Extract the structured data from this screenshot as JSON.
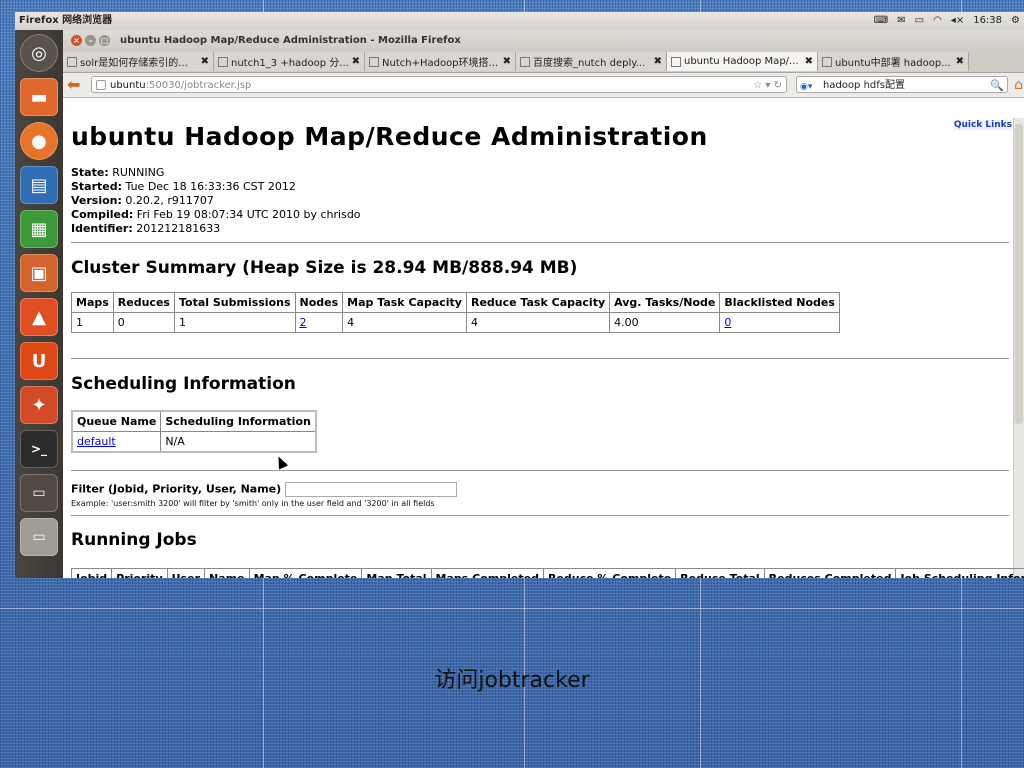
{
  "top_panel": {
    "app_name": "Firefox 网络浏览器",
    "clock": "16:38"
  },
  "window": {
    "title": "ubuntu Hadoop Map/Reduce Administration - Mozilla Firefox",
    "tabs": [
      {
        "label": "solr是如何存储索引的...",
        "active": false
      },
      {
        "label": "nutch1_3 +hadoop 分...",
        "active": false
      },
      {
        "label": "Nutch+Hadoop环境搭...",
        "active": false
      },
      {
        "label": "百度搜索_nutch deply...",
        "active": false
      },
      {
        "label": "ubuntu Hadoop Map/...",
        "active": true
      },
      {
        "label": "ubuntu中部署 hadoop...",
        "active": false
      }
    ],
    "url_host": "ubuntu",
    "url_path": ":50030/jobtracker.jsp",
    "search_value": "hadoop hdfs配置"
  },
  "page": {
    "quick_links": "Quick Links",
    "title": "ubuntu Hadoop Map/Reduce Administration",
    "info": [
      {
        "label": "State:",
        "value": "RUNNING"
      },
      {
        "label": "Started:",
        "value": "Tue Dec 18 16:33:36 CST 2012"
      },
      {
        "label": "Version:",
        "value": "0.20.2, r911707"
      },
      {
        "label": "Compiled:",
        "value": "Fri Feb 19 08:07:34 UTC 2010 by chrisdo"
      },
      {
        "label": "Identifier:",
        "value": "201212181633"
      }
    ],
    "cluster_summary": {
      "heading": "Cluster Summary (Heap Size is 28.94 MB/888.94 MB)",
      "headers": [
        "Maps",
        "Reduces",
        "Total Submissions",
        "Nodes",
        "Map Task Capacity",
        "Reduce Task Capacity",
        "Avg. Tasks/Node",
        "Blacklisted Nodes"
      ],
      "row": [
        "1",
        "0",
        "1",
        "2",
        "4",
        "4",
        "4.00",
        "0"
      ]
    },
    "scheduling": {
      "heading": "Scheduling Information",
      "headers": [
        "Queue Name",
        "Scheduling Information"
      ],
      "row": [
        "default",
        "N/A"
      ]
    },
    "filter": {
      "label": "Filter (Jobid, Priority, User, Name)",
      "value": "",
      "example": "Example: 'user:smith 3200' will filter by 'smith' only in the user field and '3200' in all fields"
    },
    "running_jobs": {
      "heading": "Running Jobs",
      "headers": [
        "Jobid",
        "Priority",
        "User",
        "Name",
        "Map % Complete",
        "Map Total",
        "Maps Completed",
        "Reduce % Complete",
        "Reduce Total",
        "Reduces Completed",
        "Job Scheduling Information"
      ]
    }
  },
  "slide_caption": "访问jobtracker"
}
